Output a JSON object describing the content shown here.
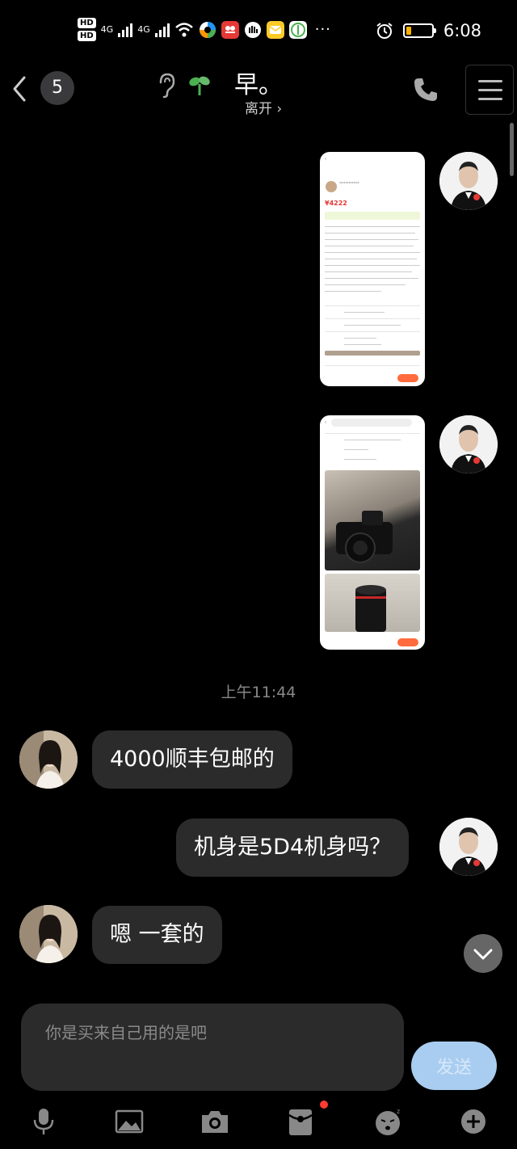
{
  "status_bar": {
    "hd1": "HD",
    "hd2": "HD",
    "net1": "4G",
    "net2": "4G",
    "more": "···",
    "time": "6:08",
    "battery_color": "#ffb300"
  },
  "header": {
    "unread_count": "5",
    "contact_name": "早。",
    "contact_status": "离开 ›"
  },
  "messages": {
    "timestamp": "上午11:44",
    "her_msg_1": "4000顺丰包邮的",
    "my_msg_1": "机身是5D4机身吗？",
    "her_msg_2": "嗯 一套的"
  },
  "image_msg_1": {
    "price": "¥4222"
  },
  "input": {
    "placeholder_text": "你是买来自己用的是吧",
    "send_label": "发送"
  },
  "colors": {
    "background": "#000000",
    "bubble": "#2b2b2b",
    "send_button": "#a9cdf0",
    "badge": "#ff3b30"
  }
}
